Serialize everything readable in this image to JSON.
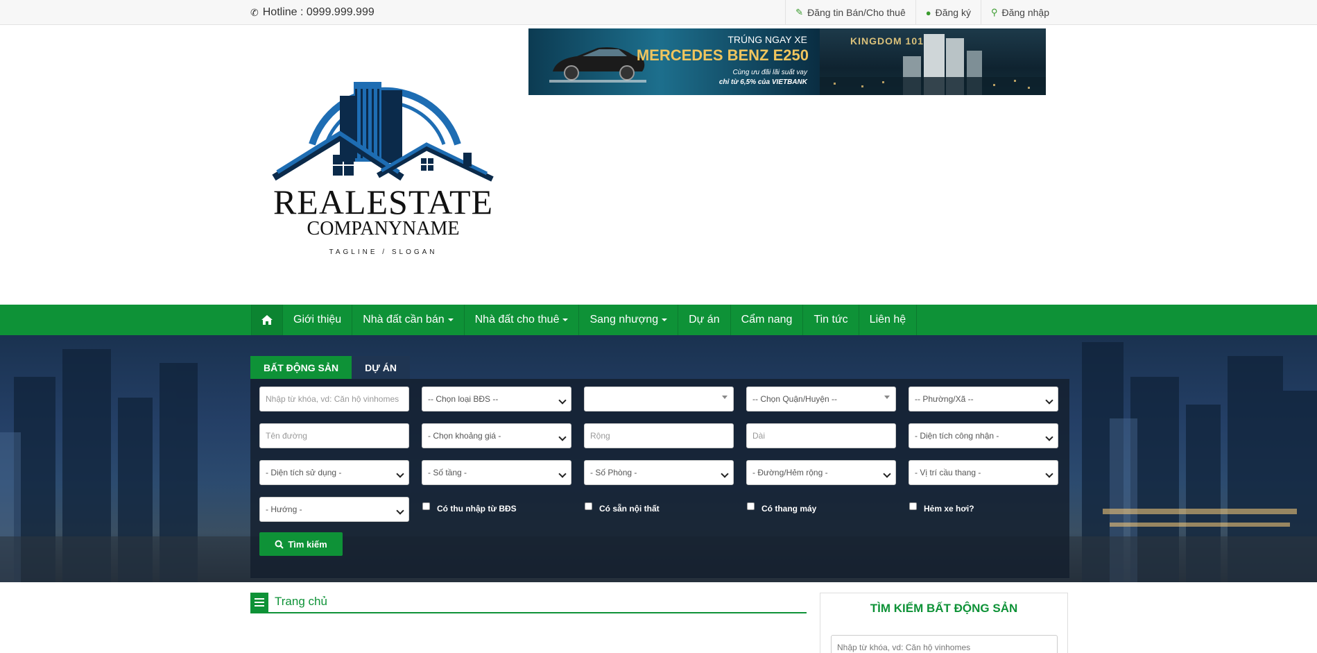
{
  "topbar": {
    "hotline": "Hotline : 0999.999.999",
    "links": [
      {
        "label": "Đăng tin Bán/Cho thuê",
        "icon": "edit-icon"
      },
      {
        "label": "Đăng ký",
        "icon": "user-icon"
      },
      {
        "label": "Đăng nhập",
        "icon": "key-icon"
      }
    ]
  },
  "logo": {
    "line1": "REALESTATE",
    "line2": "COMPANYNAME",
    "tagline": "TAGLINE / SLOGAN"
  },
  "banner": {
    "promo_title": "TRÚNG NGAY XE",
    "promo_car": "MERCEDES BENZ E250",
    "promo_sub1": "Cùng ưu đãi lãi suất vay",
    "promo_sub2": "chỉ từ 6,5% của VIETBANK",
    "project": "KINGDOM 101"
  },
  "nav": {
    "home_icon": "home-icon",
    "items": [
      {
        "label": "Giới thiệu",
        "dropdown": false
      },
      {
        "label": "Nhà đất cần bán",
        "dropdown": true
      },
      {
        "label": "Nhà đất cho thuê",
        "dropdown": true
      },
      {
        "label": "Sang nhượng",
        "dropdown": true
      },
      {
        "label": "Dự án",
        "dropdown": false
      },
      {
        "label": "Cẩm nang",
        "dropdown": false
      },
      {
        "label": "Tin tức",
        "dropdown": false
      },
      {
        "label": "Liên hệ",
        "dropdown": false
      }
    ]
  },
  "search": {
    "tabs": [
      "BẤT ĐỘNG SẢN",
      "DỰ ÁN"
    ],
    "keyword_placeholder": "Nhập từ khóa, vd: Căn hộ vinhomes",
    "type_select": "-- Chọn loại BĐS --",
    "city_select": "",
    "district_select": "-- Chọn Quận/Huyện --",
    "ward_select": "-- Phường/Xã --",
    "street_placeholder": "Tên đường",
    "price_select": "- Chọn khoảng giá -",
    "width_placeholder": "Rộng",
    "length_placeholder": "Dài",
    "recognized_area_select": "- Diện tích công nhận -",
    "used_area_select": "- Diện tích sử dụng -",
    "floors_select": "- Số tầng -",
    "rooms_select": "- Số Phòng -",
    "road_width_select": "- Đường/Hẻm rộng -",
    "stair_position_select": "- Vị trí cầu thang -",
    "direction_select": "- Hướng -",
    "checkboxes": [
      "Có thu nhập từ BĐS",
      "Có sẵn nội thất",
      "Có thang máy",
      "Hẻm xe hơi?"
    ],
    "button": "Tìm kiếm"
  },
  "breadcrumb": {
    "label": "Trang chủ"
  },
  "sidebar": {
    "title": "TÌM KIẾM BẤT ĐỘNG SẢN",
    "keyword_placeholder": "Nhập từ khóa, vd: Căn hộ vinhomes"
  },
  "colors": {
    "brand_green": "#0e9237",
    "logo_blue": "#1e6db3"
  }
}
